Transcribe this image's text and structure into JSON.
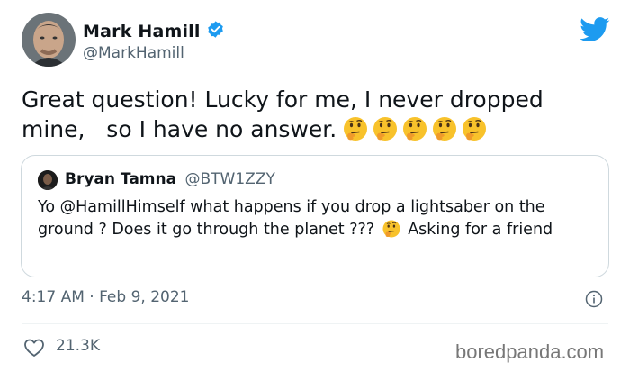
{
  "author": {
    "name": "Mark Hamill",
    "handle": "@MarkHamill"
  },
  "tweet": {
    "text": "Great question! Lucky for me, I never dropped mine,   so I have no answer.",
    "emoji_count": 5,
    "emoji_icon": "thinking-face-icon"
  },
  "quote": {
    "name": "Bryan Tamna",
    "handle": "@BTW1ZZY",
    "text_before": "Yo @HamillHimself what happens if you drop a lightsaber on the ground ? Does it go through the planet ??? ",
    "text_after": " Asking for a friend"
  },
  "meta": {
    "timestamp": "4:17 AM · Feb 9, 2021"
  },
  "stats": {
    "likes": "21.3K"
  },
  "watermark": "boredpanda.com",
  "colors": {
    "verified": "#1d9bf0",
    "twitter": "#1d9bf0",
    "secondary_text": "#536471"
  }
}
